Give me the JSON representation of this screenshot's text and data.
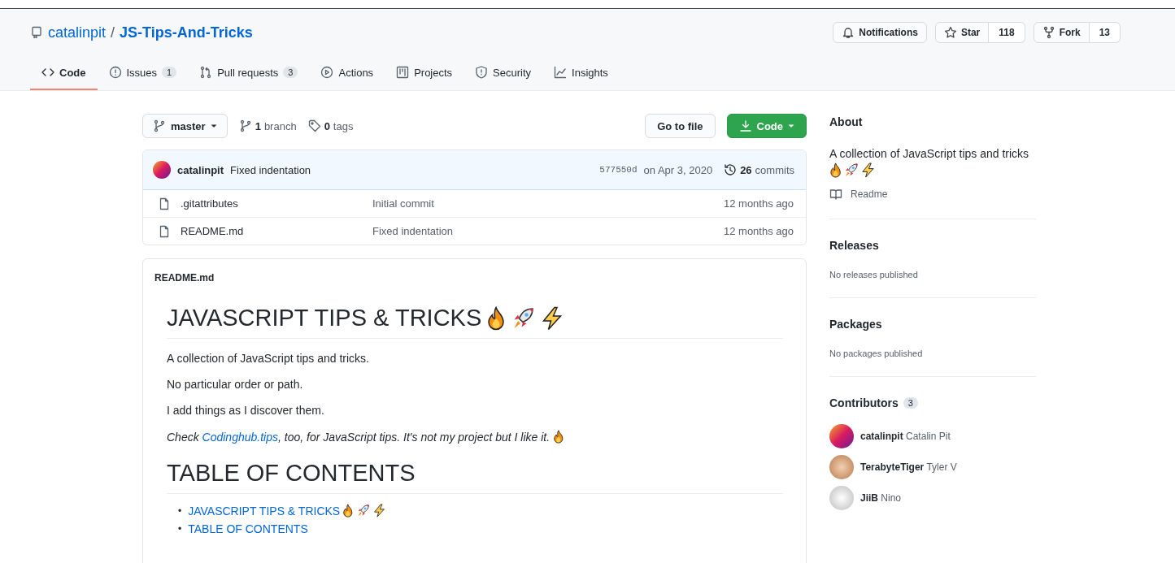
{
  "repo": {
    "owner": "catalinpit",
    "separator": "/",
    "name": "JS-Tips-And-Tricks"
  },
  "header_actions": {
    "notifications": "Notifications",
    "star": {
      "label": "Star",
      "count": "118"
    },
    "fork": {
      "label": "Fork",
      "count": "13"
    }
  },
  "tabs": [
    {
      "kind": "code",
      "label": "Code",
      "selected": true
    },
    {
      "kind": "issues",
      "label": "Issues",
      "count": "1",
      "selected": false
    },
    {
      "kind": "pulls",
      "label": "Pull requests",
      "count": "3",
      "selected": false
    },
    {
      "kind": "actions",
      "label": "Actions",
      "selected": false
    },
    {
      "kind": "projects",
      "label": "Projects",
      "selected": false
    },
    {
      "kind": "security",
      "label": "Security",
      "selected": false
    },
    {
      "kind": "insights",
      "label": "Insights",
      "selected": false
    }
  ],
  "branch_bar": {
    "branch": "master",
    "branches_count": "1",
    "branches_label": "branch",
    "tags_count": "0",
    "tags_label": "tags",
    "go_to_file": "Go to file",
    "code": "Code"
  },
  "commit": {
    "author": "catalinpit",
    "message": "Fixed indentation",
    "hash": "577550d",
    "date": "on Apr 3, 2020",
    "count": "26",
    "count_label": "commits"
  },
  "files": [
    {
      "name": ".gitattributes",
      "message": "Initial commit",
      "age": "12 months ago"
    },
    {
      "name": "README.md",
      "message": "Fixed indentation",
      "age": "12 months ago"
    }
  ],
  "readme": {
    "filename": "README.md",
    "title": "JAVASCRIPT TIPS & TRICKS",
    "paragraphs": [
      "A collection of JavaScript tips and tricks.",
      "No particular order or path.",
      "I add things as I discover them."
    ],
    "note": {
      "before": "Check ",
      "link": "Codinghub.tips",
      "after": ", too, for JavaScript tips. It's not my project but I like it."
    },
    "toc_title": "TABLE OF CONTENTS",
    "toc": [
      {
        "marker": "•",
        "label": "JAVASCRIPT TIPS & TRICKS",
        "emoji": true
      },
      {
        "marker": "•",
        "label": "TABLE OF CONTENTS",
        "emoji": false
      }
    ]
  },
  "sidebar": {
    "about_title": "About",
    "description": "A collection of JavaScript tips and tricks",
    "readme_link": "Readme",
    "releases_title": "Releases",
    "releases_text": "No releases published",
    "packages_title": "Packages",
    "packages_text": "No packages published",
    "contributors_title": "Contributors",
    "contributors_count": "3",
    "contributors": [
      {
        "login": "catalinpit",
        "name": "Catalin Pit"
      },
      {
        "login": "TerabyteTiger",
        "name": "Tyler V"
      },
      {
        "login": "JiiB",
        "name": "Nino"
      }
    ]
  }
}
